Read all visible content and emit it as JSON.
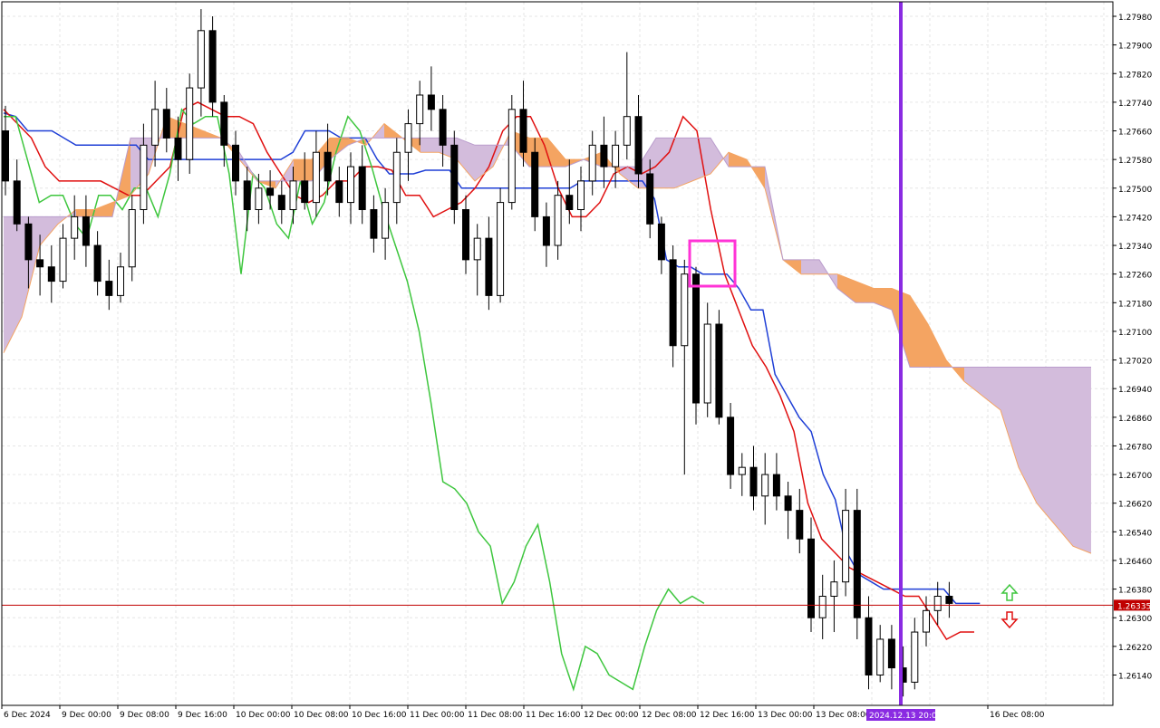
{
  "chart_data": {
    "type": "candlestick",
    "grid": true,
    "ylim": [
      1.2606,
      1.2802
    ],
    "y_ticks": [
      1.2798,
      1.279,
      1.2782,
      1.2774,
      1.2766,
      1.2758,
      1.275,
      1.2742,
      1.2734,
      1.2726,
      1.2718,
      1.271,
      1.2702,
      1.2694,
      1.2686,
      1.2678,
      1.267,
      1.2662,
      1.2654,
      1.2646,
      1.2638,
      1.263,
      1.2622,
      1.2614
    ],
    "y_tick_labels": [
      "1.27980",
      "1.27900",
      "1.27820",
      "1.27740",
      "1.27660",
      "1.27580",
      "1.27500",
      "1.27420",
      "1.27340",
      "1.27260",
      "1.27180",
      "1.27100",
      "1.27020",
      "1.26940",
      "1.26860",
      "1.26780",
      "1.26700",
      "1.26620",
      "1.26540",
      "1.26460",
      "1.26380",
      "1.26300",
      "1.26220",
      "1.26140"
    ],
    "x_tick_labels": [
      "6 Dec 2024",
      "9 Dec 00:00",
      "9 Dec 08:00",
      "9 Dec 16:00",
      "10 Dec 00:00",
      "10 Dec 08:00",
      "10 Dec 16:00",
      "11 Dec 00:00",
      "11 Dec 08:00",
      "11 Dec 16:00",
      "12 Dec 00:00",
      "12 Dec 08:00",
      "12 Dec 16:00",
      "13 Dec 00:00",
      "13 Dec 08:00",
      "",
      "",
      "16 Dec 08:00"
    ],
    "current_price": 1.26335,
    "current_price_label": "1.26335",
    "vertical_marker_label": "2024.12.13 20:00",
    "candles": [
      [
        1.2766,
        1.2773,
        1.2748,
        1.2752
      ],
      [
        1.2752,
        1.2758,
        1.2738,
        1.274
      ],
      [
        1.274,
        1.2742,
        1.2722,
        1.273
      ],
      [
        1.273,
        1.2737,
        1.272,
        1.2728
      ],
      [
        1.2728,
        1.2734,
        1.2718,
        1.2724
      ],
      [
        1.2724,
        1.274,
        1.2722,
        1.2736
      ],
      [
        1.2736,
        1.2748,
        1.273,
        1.2742
      ],
      [
        1.2742,
        1.2748,
        1.2728,
        1.2734
      ],
      [
        1.2734,
        1.2738,
        1.272,
        1.2724
      ],
      [
        1.2724,
        1.273,
        1.2716,
        1.272
      ],
      [
        1.272,
        1.2732,
        1.2718,
        1.2728
      ],
      [
        1.2728,
        1.2748,
        1.2724,
        1.2744
      ],
      [
        1.2744,
        1.2768,
        1.274,
        1.2762
      ],
      [
        1.2762,
        1.278,
        1.2756,
        1.2772
      ],
      [
        1.2772,
        1.2778,
        1.276,
        1.2764
      ],
      [
        1.2764,
        1.277,
        1.2752,
        1.2758
      ],
      [
        1.2758,
        1.2782,
        1.2754,
        1.2778
      ],
      [
        1.2778,
        1.28,
        1.277,
        1.2794
      ],
      [
        1.2794,
        1.2798,
        1.277,
        1.2774
      ],
      [
        1.2774,
        1.2776,
        1.2756,
        1.2762
      ],
      [
        1.2762,
        1.2766,
        1.2748,
        1.2752
      ],
      [
        1.2752,
        1.2756,
        1.2738,
        1.2744
      ],
      [
        1.2744,
        1.2754,
        1.274,
        1.275
      ],
      [
        1.275,
        1.2755,
        1.2744,
        1.2748
      ],
      [
        1.2748,
        1.2752,
        1.274,
        1.2744
      ],
      [
        1.2744,
        1.2756,
        1.274,
        1.2752
      ],
      [
        1.2752,
        1.276,
        1.2744,
        1.2746
      ],
      [
        1.2746,
        1.2766,
        1.2742,
        1.276
      ],
      [
        1.276,
        1.2768,
        1.2748,
        1.2752
      ],
      [
        1.2752,
        1.2756,
        1.2742,
        1.2746
      ],
      [
        1.2746,
        1.276,
        1.274,
        1.2756
      ],
      [
        1.2756,
        1.2762,
        1.274,
        1.2744
      ],
      [
        1.2744,
        1.2748,
        1.2732,
        1.2736
      ],
      [
        1.2736,
        1.275,
        1.273,
        1.2746
      ],
      [
        1.2746,
        1.2764,
        1.274,
        1.276
      ],
      [
        1.276,
        1.2772,
        1.2752,
        1.2768
      ],
      [
        1.2768,
        1.278,
        1.2762,
        1.2776
      ],
      [
        1.2776,
        1.2784,
        1.2766,
        1.2772
      ],
      [
        1.2772,
        1.2776,
        1.2756,
        1.2762
      ],
      [
        1.2762,
        1.2766,
        1.274,
        1.2744
      ],
      [
        1.2744,
        1.2748,
        1.2726,
        1.273
      ],
      [
        1.273,
        1.274,
        1.272,
        1.2736
      ],
      [
        1.2736,
        1.2742,
        1.2716,
        1.272
      ],
      [
        1.272,
        1.275,
        1.2718,
        1.2746
      ],
      [
        1.2746,
        1.2776,
        1.2744,
        1.2772
      ],
      [
        1.2772,
        1.278,
        1.2756,
        1.276
      ],
      [
        1.276,
        1.2764,
        1.2738,
        1.2742
      ],
      [
        1.2742,
        1.2746,
        1.2728,
        1.2734
      ],
      [
        1.2734,
        1.2752,
        1.273,
        1.2748
      ],
      [
        1.2748,
        1.2758,
        1.274,
        1.2744
      ],
      [
        1.2744,
        1.2756,
        1.2738,
        1.2752
      ],
      [
        1.2752,
        1.2766,
        1.2748,
        1.2762
      ],
      [
        1.2762,
        1.277,
        1.275,
        1.2756
      ],
      [
        1.2756,
        1.2766,
        1.275,
        1.2762
      ],
      [
        1.2762,
        1.2788,
        1.2758,
        1.277
      ],
      [
        1.277,
        1.2776,
        1.275,
        1.2754
      ],
      [
        1.2754,
        1.2758,
        1.2736,
        1.274
      ],
      [
        1.274,
        1.2742,
        1.2726,
        1.273
      ],
      [
        1.273,
        1.2734,
        1.27,
        1.2706
      ],
      [
        1.2706,
        1.273,
        1.267,
        1.2726
      ],
      [
        1.2726,
        1.2728,
        1.2684,
        1.269
      ],
      [
        1.269,
        1.2718,
        1.2686,
        1.2712
      ],
      [
        1.2712,
        1.2716,
        1.2684,
        1.2686
      ],
      [
        1.2686,
        1.269,
        1.2666,
        1.267
      ],
      [
        1.267,
        1.2676,
        1.2664,
        1.2672
      ],
      [
        1.2672,
        1.2678,
        1.266,
        1.2664
      ],
      [
        1.2664,
        1.2676,
        1.2656,
        1.267
      ],
      [
        1.267,
        1.2676,
        1.266,
        1.2664
      ],
      [
        1.2664,
        1.2668,
        1.2652,
        1.266
      ],
      [
        1.266,
        1.2666,
        1.2648,
        1.2652
      ],
      [
        1.2652,
        1.2658,
        1.2626,
        1.263
      ],
      [
        1.263,
        1.2642,
        1.2624,
        1.2636
      ],
      [
        1.2636,
        1.2646,
        1.2626,
        1.264
      ],
      [
        1.264,
        1.2666,
        1.2636,
        1.266
      ],
      [
        1.266,
        1.2666,
        1.2624,
        1.263
      ],
      [
        1.263,
        1.2636,
        1.261,
        1.2614
      ],
      [
        1.2614,
        1.2628,
        1.2612,
        1.2624
      ],
      [
        1.2624,
        1.2628,
        1.261,
        1.2616
      ],
      [
        1.2616,
        1.2622,
        1.2608,
        1.2612
      ],
      [
        1.2612,
        1.263,
        1.261,
        1.2626
      ],
      [
        1.2626,
        1.2636,
        1.2622,
        1.2632
      ],
      [
        1.2632,
        1.264,
        1.2628,
        1.2636
      ],
      [
        1.2636,
        1.264,
        1.263,
        1.2634
      ]
    ],
    "series": [
      {
        "values": [
          1.2771,
          1.277,
          1.2766,
          1.2766,
          1.2766,
          1.2764,
          1.2762,
          1.2762,
          1.2762,
          1.2762,
          1.2762,
          1.2762,
          1.2758,
          1.2758,
          1.2758,
          1.2758,
          1.2758,
          1.2758,
          1.2758,
          1.2758,
          1.2758,
          1.2758,
          1.2758,
          1.2758,
          1.276,
          1.2766,
          1.2766,
          1.2766,
          1.2764,
          1.2764,
          1.2764,
          1.2758,
          1.2754,
          1.2754,
          1.2754,
          1.2755,
          1.2755,
          1.2755,
          1.275,
          1.275,
          1.275,
          1.275,
          1.275,
          1.275,
          1.275,
          1.275,
          1.275,
          1.275,
          1.2752,
          1.2752,
          1.2752,
          1.2752,
          1.2752,
          1.2752,
          1.2747,
          1.273,
          1.2728,
          1.2728,
          1.2726,
          1.2726,
          1.2726,
          1.2722,
          1.2716,
          1.2716,
          1.2698,
          1.2692,
          1.2686,
          1.2682,
          1.267,
          1.2663,
          1.2648,
          1.2642,
          1.264,
          1.2638,
          1.2638,
          1.2638,
          1.2638,
          1.2638,
          1.2638,
          1.2634,
          1.2634,
          1.2634
        ]
      },
      {
        "values": [
          1.2772,
          1.2768,
          1.2764,
          1.2756,
          1.2752,
          1.2752,
          1.2752,
          1.2752,
          1.275,
          1.2748,
          1.2748,
          1.2752,
          1.2756,
          1.2772,
          1.2774,
          1.2772,
          1.277,
          1.277,
          1.2768,
          1.276,
          1.2754,
          1.2748,
          1.2746,
          1.2748,
          1.2752,
          1.2752,
          1.2756,
          1.2756,
          1.2755,
          1.2748,
          1.2748,
          1.2742,
          1.2744,
          1.2746,
          1.275,
          1.2756,
          1.2766,
          1.277,
          1.277,
          1.2762,
          1.275,
          1.2742,
          1.2742,
          1.2746,
          1.2754,
          1.2756,
          1.2754,
          1.2756,
          1.276,
          1.277,
          1.2766,
          1.2744,
          1.2726,
          1.2716,
          1.2706,
          1.27,
          1.2692,
          1.2682,
          1.2662,
          1.2652,
          1.2648,
          1.2644,
          1.2642,
          1.264,
          1.2638,
          1.2636,
          1.2636,
          1.263,
          1.2624,
          1.2626,
          1.2626
        ]
      },
      {
        "values": [
          1.277,
          1.277,
          1.2758,
          1.2746,
          1.2748,
          1.2748,
          1.274,
          1.2736,
          1.2748,
          1.2748,
          1.2744,
          1.275,
          1.275,
          1.2742,
          1.2754,
          1.2772,
          1.2768,
          1.277,
          1.277,
          1.2754,
          1.2726,
          1.2754,
          1.275,
          1.274,
          1.2736,
          1.2752,
          1.274,
          1.2746,
          1.276,
          1.277,
          1.2766,
          1.2756,
          1.2744,
          1.2734,
          1.2724,
          1.271,
          1.269,
          1.2668,
          1.2666,
          1.2662,
          1.2654,
          1.265,
          1.2634,
          1.264,
          1.265,
          1.2656,
          1.264,
          1.262,
          1.261,
          1.2622,
          1.262,
          1.2614,
          1.2612,
          1.261,
          1.2622,
          1.2632,
          1.2638,
          1.2634,
          1.2636,
          1.2634
        ]
      },
      {
        "name": "span-a",
        "values": [
          1.2704,
          1.2714,
          1.2734,
          1.274,
          1.2744,
          1.2744,
          1.2746,
          1.2748,
          1.2754,
          1.277,
          1.2768,
          1.2766,
          1.2764,
          1.2758,
          1.2752,
          1.275,
          1.2758,
          1.2758,
          1.2764,
          1.2764,
          1.2762,
          1.2768,
          1.2764,
          1.276,
          1.276,
          1.2758,
          1.2752,
          1.2756,
          1.2766,
          1.2764,
          1.2764,
          1.2758,
          1.2758,
          1.276,
          1.2754,
          1.275,
          1.275,
          1.275,
          1.2752,
          1.2754,
          1.276,
          1.2758,
          1.275,
          1.273,
          1.2726,
          1.2726,
          1.2726,
          1.2724,
          1.2722,
          1.2722,
          1.272,
          1.2712,
          1.2702,
          1.2696,
          1.2692,
          1.2688,
          1.2672,
          1.2662,
          1.2656,
          1.265,
          1.2648
        ]
      },
      {
        "name": "span-b",
        "values": [
          1.2742,
          1.2742,
          1.2742,
          1.2742,
          1.2742,
          1.2742,
          1.2742,
          1.2764,
          1.2764,
          1.2764,
          1.2764,
          1.2764,
          1.2764,
          1.276,
          1.2752,
          1.2752,
          1.2752,
          1.2752,
          1.2758,
          1.2762,
          1.2764,
          1.2764,
          1.2764,
          1.2764,
          1.2764,
          1.2764,
          1.2762,
          1.2762,
          1.2762,
          1.2756,
          1.2756,
          1.2756,
          1.2758,
          1.2756,
          1.2756,
          1.2756,
          1.2764,
          1.2764,
          1.2764,
          1.2764,
          1.2756,
          1.2756,
          1.2756,
          1.273,
          1.273,
          1.273,
          1.2722,
          1.2718,
          1.2718,
          1.2716,
          1.27,
          1.27,
          1.27,
          1.27,
          1.27,
          1.27,
          1.27,
          1.27,
          1.27,
          1.27,
          1.27
        ]
      }
    ]
  }
}
